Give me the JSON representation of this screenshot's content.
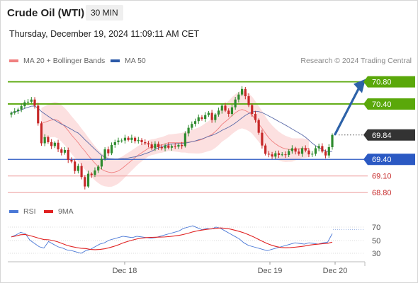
{
  "header": {
    "title": "Crude Oil (WTI)",
    "timeframe": "30 MIN",
    "timestamp": "Thursday, December 19, 2024 11:09:11 AM CET",
    "credit": "Research © 2024 Trading Central"
  },
  "legend": {
    "ma20": "MA 20 + Bollinger Bands",
    "ma50": "MA 50",
    "rsi": "RSI",
    "ma9": "9MA"
  },
  "colors": {
    "up": "#2e8b2e",
    "down": "#c62828",
    "resistance": "#5aa80a",
    "support": "#2b59c3",
    "weak_support": "#ee9a9a",
    "bollinger": "#fbd5d5",
    "ma20": "#f08080",
    "ma50": "#5a6aa8",
    "rsi": "#4a78d6",
    "rsi_ma": "#e02020",
    "last": "#333333",
    "arrow": "#2d62a8"
  },
  "chart_data": [
    {
      "type": "candlestick",
      "title": "Crude Oil (WTI)",
      "ylim": [
        68.7,
        71.0
      ],
      "x_ticks": [
        "Dec 18",
        "Dec 19",
        "Dec 20"
      ],
      "levels": [
        {
          "value": 70.8,
          "label": "70.80",
          "kind": "resistance"
        },
        {
          "value": 70.4,
          "label": "70.40",
          "kind": "resistance"
        },
        {
          "value": 69.84,
          "label": "69.84",
          "kind": "last"
        },
        {
          "value": 69.4,
          "label": "69.40",
          "kind": "pivot"
        },
        {
          "value": 69.1,
          "label": "69.10",
          "kind": "support"
        },
        {
          "value": 68.8,
          "label": "68.80",
          "kind": "support"
        }
      ],
      "closes": [
        70.24,
        70.27,
        70.3,
        70.36,
        70.43,
        70.44,
        70.48,
        70.37,
        70.05,
        69.69,
        69.8,
        69.71,
        69.64,
        69.7,
        69.58,
        69.52,
        69.57,
        69.39,
        69.36,
        69.19,
        69.28,
        69.08,
        68.91,
        69.14,
        69.12,
        69.2,
        69.27,
        69.41,
        69.58,
        69.51,
        69.66,
        69.71,
        69.74,
        69.74,
        69.79,
        69.75,
        69.79,
        69.73,
        69.75,
        69.71,
        69.69,
        69.67,
        69.6,
        69.68,
        69.62,
        69.6,
        69.65,
        69.61,
        69.64,
        69.63,
        69.66,
        69.64,
        69.87,
        69.97,
        70.04,
        70.09,
        70.16,
        70.13,
        70.2,
        70.24,
        70.11,
        70.21,
        70.28,
        70.37,
        70.28,
        70.22,
        70.34,
        70.48,
        70.57,
        70.67,
        70.54,
        70.38,
        70.22,
        70.11,
        69.88,
        69.65,
        69.5,
        69.49,
        69.45,
        69.51,
        69.48,
        69.49,
        69.48,
        69.55,
        69.6,
        69.54,
        69.5,
        69.6,
        69.56,
        69.49,
        69.5,
        69.6,
        69.64,
        69.54,
        69.47,
        69.62,
        69.84
      ],
      "ma20": [
        70.05,
        70.07,
        70.09,
        70.11,
        70.12,
        70.1,
        70.05,
        69.99,
        69.92,
        69.84,
        69.77,
        69.7,
        69.62,
        69.55,
        69.47,
        69.4,
        69.33,
        69.27,
        69.22,
        69.19,
        69.17,
        69.16,
        69.17,
        69.19,
        69.23,
        69.28,
        69.33,
        69.38,
        69.43,
        69.48,
        69.52,
        69.56,
        69.6,
        69.62,
        69.63,
        69.65,
        69.66,
        69.68,
        69.7,
        69.7,
        69.7,
        69.7,
        69.7,
        69.71,
        69.71,
        69.72,
        69.73,
        69.74,
        69.76,
        69.79,
        69.82,
        69.85,
        69.9,
        69.96,
        70.03,
        70.08,
        70.13,
        70.19,
        70.24,
        70.28,
        70.3,
        70.28,
        70.25,
        70.2,
        70.12,
        70.04,
        69.96,
        69.87,
        69.79,
        69.73,
        69.68,
        69.64,
        69.61,
        69.59,
        69.58,
        69.57,
        69.58,
        69.59,
        69.6,
        69.6,
        69.6
      ],
      "rsi": [
        55,
        58,
        62,
        60,
        50,
        45,
        40,
        38,
        48,
        44,
        40,
        38,
        35,
        34,
        32,
        30,
        34,
        36,
        40,
        44,
        46,
        50,
        52,
        54,
        56,
        55,
        54,
        56,
        55,
        54,
        53,
        54,
        56,
        58,
        60,
        62,
        64,
        68,
        70,
        72,
        69,
        66,
        68,
        67,
        70,
        68,
        64,
        60,
        56,
        52,
        46,
        42,
        40,
        38,
        36,
        34,
        36,
        38,
        40,
        42,
        44,
        46,
        45,
        44,
        46,
        45,
        44,
        46,
        47,
        60
      ]
    }
  ]
}
